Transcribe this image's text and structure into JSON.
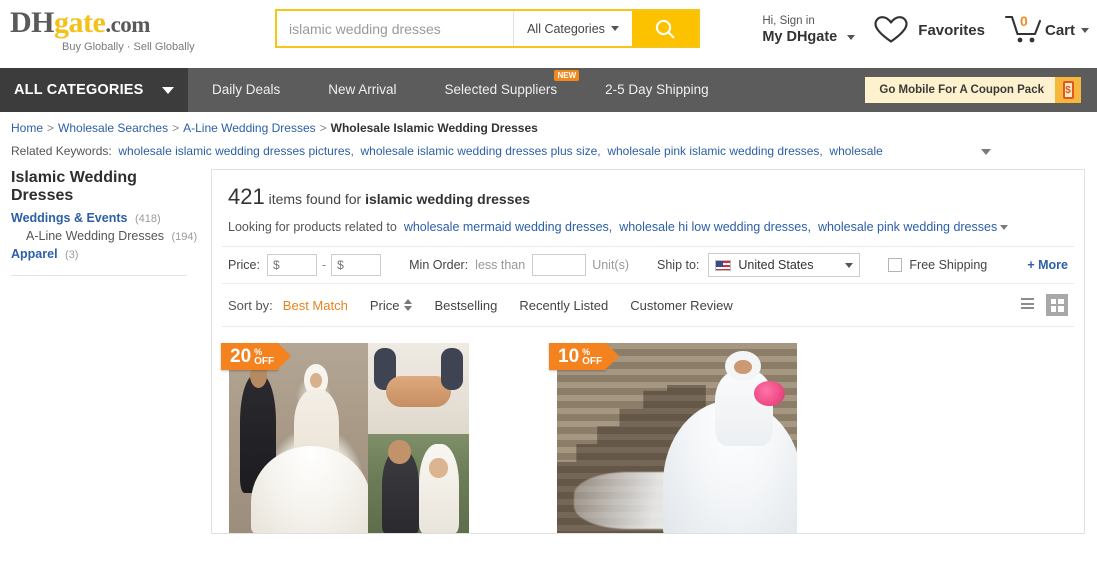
{
  "header": {
    "logo": {
      "part1": "DH",
      "part2": "gate",
      "part3": ".com",
      "tagline": "Buy Globally · Sell Globally"
    },
    "search": {
      "placeholder": "islamic wedding dresses",
      "value": "",
      "category_label": "All Categories",
      "button_icon": "search-icon"
    },
    "account": {
      "greeting": "Hi, Sign in",
      "menu_label": "My DHgate"
    },
    "favorites": {
      "label": "Favorites",
      "icon": "heart-icon"
    },
    "cart": {
      "label": "Cart",
      "count": "0",
      "icon": "cart-icon"
    }
  },
  "nav": {
    "all_categories": "ALL CATEGORIES",
    "items": [
      {
        "label": "Daily Deals",
        "badge": ""
      },
      {
        "label": "New Arrival",
        "badge": ""
      },
      {
        "label": "Selected Suppliers",
        "badge": "NEW"
      },
      {
        "label": "2-5 Day Shipping",
        "badge": ""
      }
    ],
    "coupon": {
      "label": "Go Mobile For A Coupon Pack",
      "icon": "mobile-dollar-icon",
      "symbol": "$"
    }
  },
  "breadcrumb": {
    "items": [
      "Home",
      "Wholesale Searches",
      "A-Line Wedding Dresses"
    ],
    "current": "Wholesale Islamic Wedding Dresses",
    "separator": ">"
  },
  "related_keywords": {
    "label": "Related Keywords:",
    "items": [
      "wholesale islamic wedding dresses pictures,",
      "wholesale islamic wedding dresses plus size,",
      "wholesale pink islamic wedding dresses,",
      "wholesale"
    ]
  },
  "sidebar": {
    "title": "Islamic Wedding Dresses",
    "categories": [
      {
        "label": "Weddings & Events",
        "count": "(418)",
        "sub": false
      },
      {
        "label": "A-Line Wedding Dresses",
        "count": "(194)",
        "sub": true
      },
      {
        "label": "Apparel",
        "count": "(3)",
        "sub": false
      }
    ]
  },
  "results": {
    "count": "421",
    "count_suffix": "items found for",
    "keyword": "islamic wedding dresses",
    "looking_label": "Looking for products related to",
    "looking_links": [
      "wholesale mermaid wedding dresses,",
      "wholesale hi low wedding dresses,",
      "wholesale pink wedding dresses"
    ]
  },
  "filters": {
    "price_label": "Price:",
    "price_min": "",
    "price_max": "",
    "price_symbol": "$",
    "price_dash": "-",
    "min_order_label": "Min Order:",
    "min_order_prefix": "less than",
    "min_order_value": "",
    "units_label": "Unit(s)",
    "ship_to_label": "Ship to:",
    "ship_to_value": "United States",
    "free_shipping_label": "Free Shipping",
    "free_shipping_checked": false,
    "more_label": "+ More"
  },
  "sort": {
    "label": "Sort by:",
    "options": [
      {
        "label": "Best Match",
        "active": true,
        "arrows": false
      },
      {
        "label": "Price",
        "active": false,
        "arrows": true
      },
      {
        "label": "Bestselling",
        "active": false,
        "arrows": false
      },
      {
        "label": "Recently Listed",
        "active": false,
        "arrows": false
      },
      {
        "label": "Customer Review",
        "active": false,
        "arrows": false
      }
    ],
    "view_list_icon": "list-view-icon",
    "view_grid_icon": "grid-view-icon",
    "active_view": "grid"
  },
  "products": [
    {
      "discount_num": "20",
      "discount_pct": "%",
      "discount_off": "OFF",
      "image_alt": "islamic-wedding-dress-collage"
    },
    {
      "discount_num": "10",
      "discount_pct": "%",
      "discount_off": "OFF",
      "image_alt": "islamic-bride-on-stairs"
    }
  ],
  "colors": {
    "brand_yellow": "#f5c518",
    "search_button": "#fcc200",
    "nav_bg": "#5c5c5c",
    "nav_allcat_bg": "#3c3c3c",
    "accent_orange": "#f3821f",
    "link_blue": "#2b5fa8",
    "sort_active": "#e8821e"
  }
}
